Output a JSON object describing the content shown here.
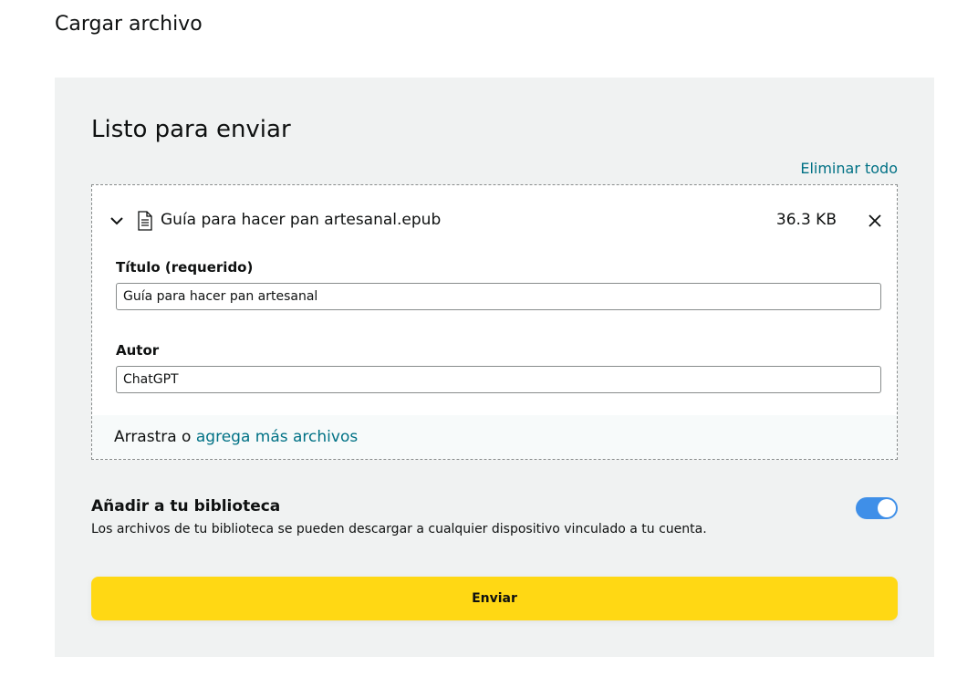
{
  "page": {
    "title": "Cargar archivo"
  },
  "panel": {
    "heading": "Listo para enviar",
    "remove_all_label": "Eliminar todo"
  },
  "file": {
    "name": "Guía para hacer pan artesanal.epub",
    "size": "36.3 KB",
    "expand_icon": "chevron-down-icon",
    "type_icon": "document-icon",
    "remove_icon": "close-icon"
  },
  "fields": {
    "title_label": "Título (requerido)",
    "title_value": "Guía para hacer pan artesanal",
    "author_label": "Autor",
    "author_value": "ChatGPT"
  },
  "drop_zone": {
    "prefix": "Arrastra o ",
    "link": "agrega más archivos"
  },
  "library": {
    "title": "Añadir a tu biblioteca",
    "description": "Los archivos de tu biblioteca se pueden descargar a cualquier dispositivo vinculado a tu cuenta.",
    "enabled": true
  },
  "submit": {
    "label": "Enviar"
  },
  "colors": {
    "panel_bg": "#f0f2f2",
    "link": "#007185",
    "toggle_on": "#3f8fe8",
    "button": "#ffd814"
  }
}
